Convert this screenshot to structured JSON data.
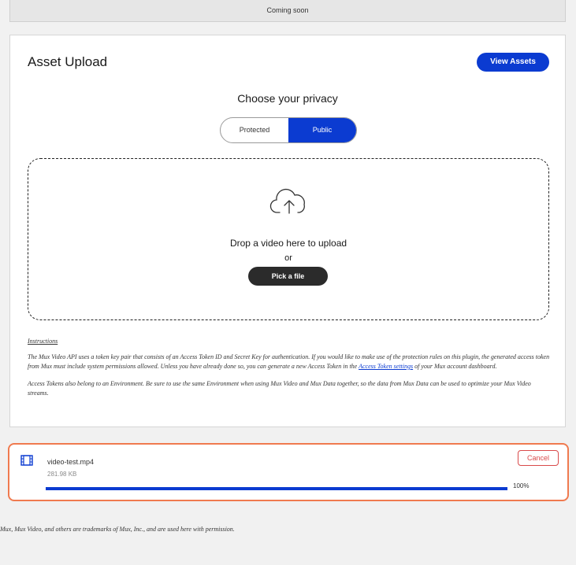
{
  "banner": {
    "text": "Coming soon"
  },
  "asset_upload": {
    "title": "Asset Upload",
    "view_assets_label": "View Assets",
    "privacy_heading": "Choose your privacy",
    "privacy_options": [
      "Protected",
      "Public"
    ],
    "privacy_selected": "Public",
    "drop_text": "Drop a video here to upload",
    "or_text": "or",
    "pick_file_label": "Pick a file"
  },
  "instructions": {
    "heading": "Instructions",
    "p1_before": "The Mux Video API uses a token key pair that consists of an Access Token ID and Secret Key for authentication. If you would like to make use of the protection rules on this plugin, the generated access token from Mux must include system permissions allowed. Unless you have already done so, you can generate a new Access Token in the ",
    "p1_link": "Access Token settings",
    "p1_after": " of your Mux account dashboard.",
    "p2": "Access Tokens also belong to an Environment. Be sure to use the same Environment when using Mux Video and Mux Data together, so the data from Mux Data can be used to optimize your Mux Video streams."
  },
  "upload_item": {
    "icon": "film-icon",
    "file_name": "video-test.mp4",
    "file_size": "281.98 KB",
    "cancel_label": "Cancel",
    "progress_label": "100%",
    "progress_fraction": 1.0
  },
  "footer": {
    "text": "Mux, Mux Video, and others are trademarks of Mux, Inc., and are used here with permission."
  },
  "colors": {
    "accent": "#0b3bd1",
    "highlight_border": "#f07a4f",
    "cancel": "#d94a4a",
    "dark_button": "#2b2b2b"
  }
}
